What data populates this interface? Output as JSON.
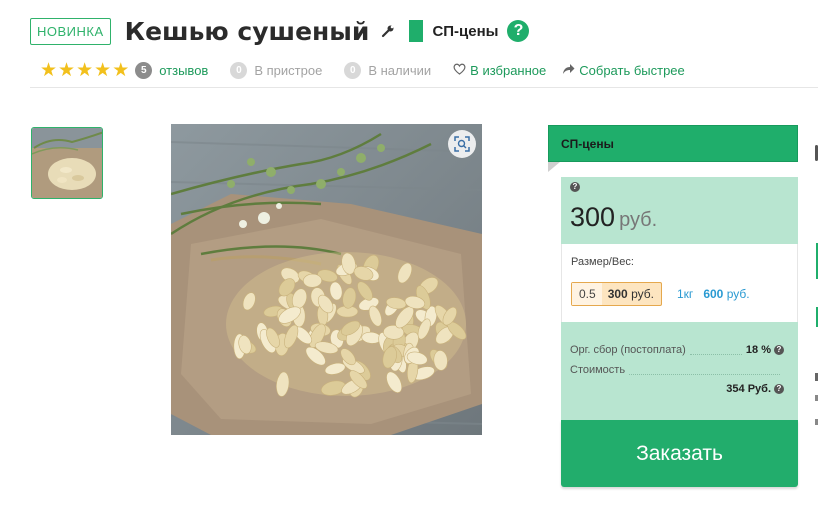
{
  "product": {
    "badge": "НОВИНКА",
    "title": "Кешью сушеный",
    "price_mode": "СП-цены",
    "help_glyph": "?"
  },
  "meta": {
    "rating_stars": 5,
    "reviews_count": "5",
    "reviews_label": "отзывов",
    "pending_count": "0",
    "pending_label": "В пристрое",
    "stock_count": "0",
    "stock_label": "В наличии",
    "favorites_label": "В избранное",
    "collect_label": "Собрать быстрее"
  },
  "panel": {
    "header": "СП-цены",
    "price_value": "300",
    "price_currency": "руб.",
    "size_label": "Размер/Вес:",
    "option_selected": {
      "weight": "0.5",
      "price": "300",
      "currency": "руб."
    },
    "option_other": {
      "weight": "1кг",
      "price": "600",
      "currency": "руб."
    },
    "org_fee_label": "Орг. сбор (постоплата)",
    "org_fee_value": "18 %",
    "cost_label": "Стоимость",
    "cost_value": "354 Руб.",
    "order_button": "Заказать"
  },
  "icons": {
    "wrench": "wrench-icon",
    "star": "star-icon",
    "heart": "heart-icon",
    "share": "share-icon",
    "zoom": "zoom-icon"
  },
  "colors": {
    "accent": "#1fae6b",
    "price_bg": "#b8e5d0",
    "star": "#f2c01c",
    "link_blue": "#2a9ad2"
  }
}
